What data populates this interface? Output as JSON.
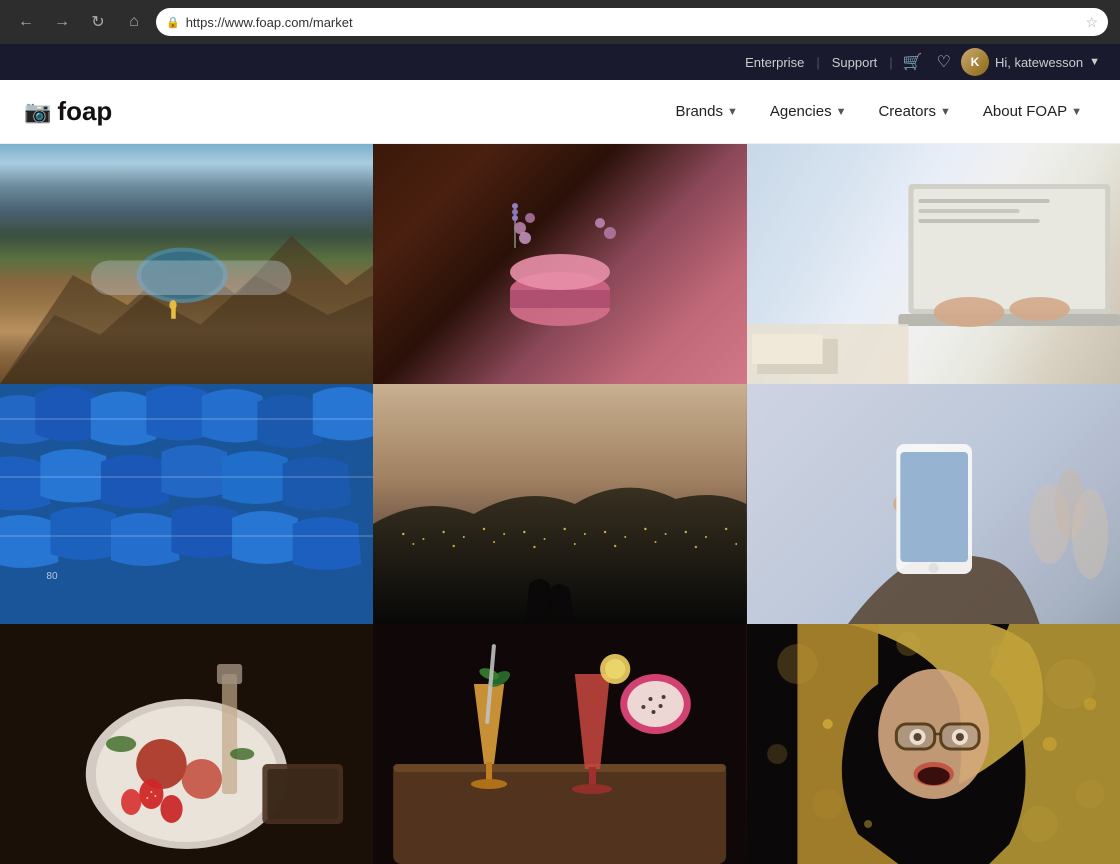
{
  "browser": {
    "back_label": "←",
    "forward_label": "→",
    "reload_label": "↻",
    "home_label": "⌂",
    "url": "https://www.foap.com/market",
    "star_label": "☆"
  },
  "utility_bar": {
    "enterprise_label": "Enterprise",
    "support_label": "Support",
    "cart_label": "🛒",
    "location_label": "♡",
    "user_greeting": "Hi, katewesson",
    "divider1": "|",
    "divider2": "|"
  },
  "nav": {
    "logo_text": "foap",
    "brands_label": "Brands",
    "agencies_label": "Agencies",
    "creators_label": "Creators",
    "about_label": "About FOAP"
  },
  "photos": {
    "row1": [
      {
        "id": "mountain",
        "alt": "Person standing on mountain overlooking volcanic crater lake",
        "style": "photo-mountain"
      },
      {
        "id": "macarons",
        "alt": "Pink macarons with lavender flowers on dark wooden surface",
        "style": "photo-macarons"
      },
      {
        "id": "laptop",
        "alt": "Person typing on laptop at desk with papers",
        "style": "photo-laptop"
      }
    ],
    "row2": [
      {
        "id": "boats",
        "alt": "Row of blue wooden boats",
        "style": "photo-boats"
      },
      {
        "id": "citynight",
        "alt": "Aerial view of city at dusk with lights",
        "style": "photo-citynight"
      },
      {
        "id": "phone",
        "alt": "Woman holding smartphone taking photo in crowd",
        "style": "photo-phone"
      }
    ],
    "row3": [
      {
        "id": "food1",
        "alt": "Overhead view of food preparation with strawberries",
        "style": "photo-food1"
      },
      {
        "id": "drinks",
        "alt": "Colorful cocktails on wooden board with food",
        "style": "photo-drinks"
      },
      {
        "id": "woman",
        "alt": "Blond woman with glasses looking surprised at bokeh lights",
        "style": "photo-woman"
      }
    ]
  }
}
